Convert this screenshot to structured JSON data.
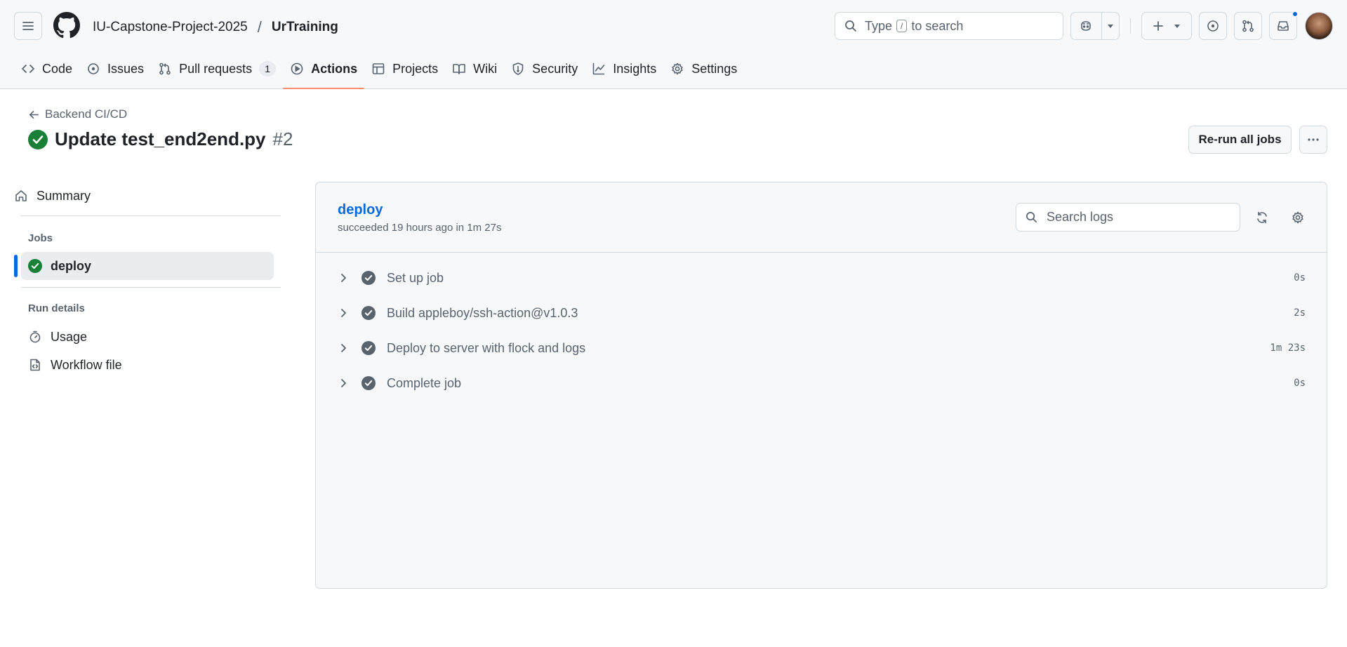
{
  "header": {
    "owner": "IU-Capstone-Project-2025",
    "separator": "/",
    "repo": "UrTraining",
    "search": {
      "prefix": "Type",
      "key": "/",
      "suffix": "to search"
    },
    "notification_dot_color": "#0969da"
  },
  "tabs": [
    {
      "label": "Code",
      "icon": "code-icon"
    },
    {
      "label": "Issues",
      "icon": "issue-opened-icon"
    },
    {
      "label": "Pull requests",
      "icon": "git-pull-request-icon",
      "counter": "1"
    },
    {
      "label": "Actions",
      "icon": "play-icon",
      "active": true
    },
    {
      "label": "Projects",
      "icon": "table-icon"
    },
    {
      "label": "Wiki",
      "icon": "book-icon"
    },
    {
      "label": "Security",
      "icon": "shield-icon"
    },
    {
      "label": "Insights",
      "icon": "graph-icon"
    },
    {
      "label": "Settings",
      "icon": "gear-icon"
    }
  ],
  "run": {
    "back_label": "Backend CI/CD",
    "title": "Update test_end2end.py",
    "number": "#2",
    "status": "success",
    "status_color": "#1a7f37",
    "rerun_label": "Re-run all jobs"
  },
  "sidebar": {
    "summary_label": "Summary",
    "jobs_heading": "Jobs",
    "job_label": "deploy",
    "run_details_heading": "Run details",
    "usage_label": "Usage",
    "workflow_label": "Workflow file",
    "accent_color": "#0969da"
  },
  "job": {
    "name": "deploy",
    "meta": "succeeded 19 hours ago in 1m 27s",
    "search_placeholder": "Search logs",
    "steps": [
      {
        "name": "Set up job",
        "duration": "0s"
      },
      {
        "name": "Build appleboy/ssh-action@v1.0.3",
        "duration": "2s"
      },
      {
        "name": "Deploy to server with flock and logs",
        "duration": "1m 23s"
      },
      {
        "name": "Complete job",
        "duration": "0s"
      }
    ]
  }
}
